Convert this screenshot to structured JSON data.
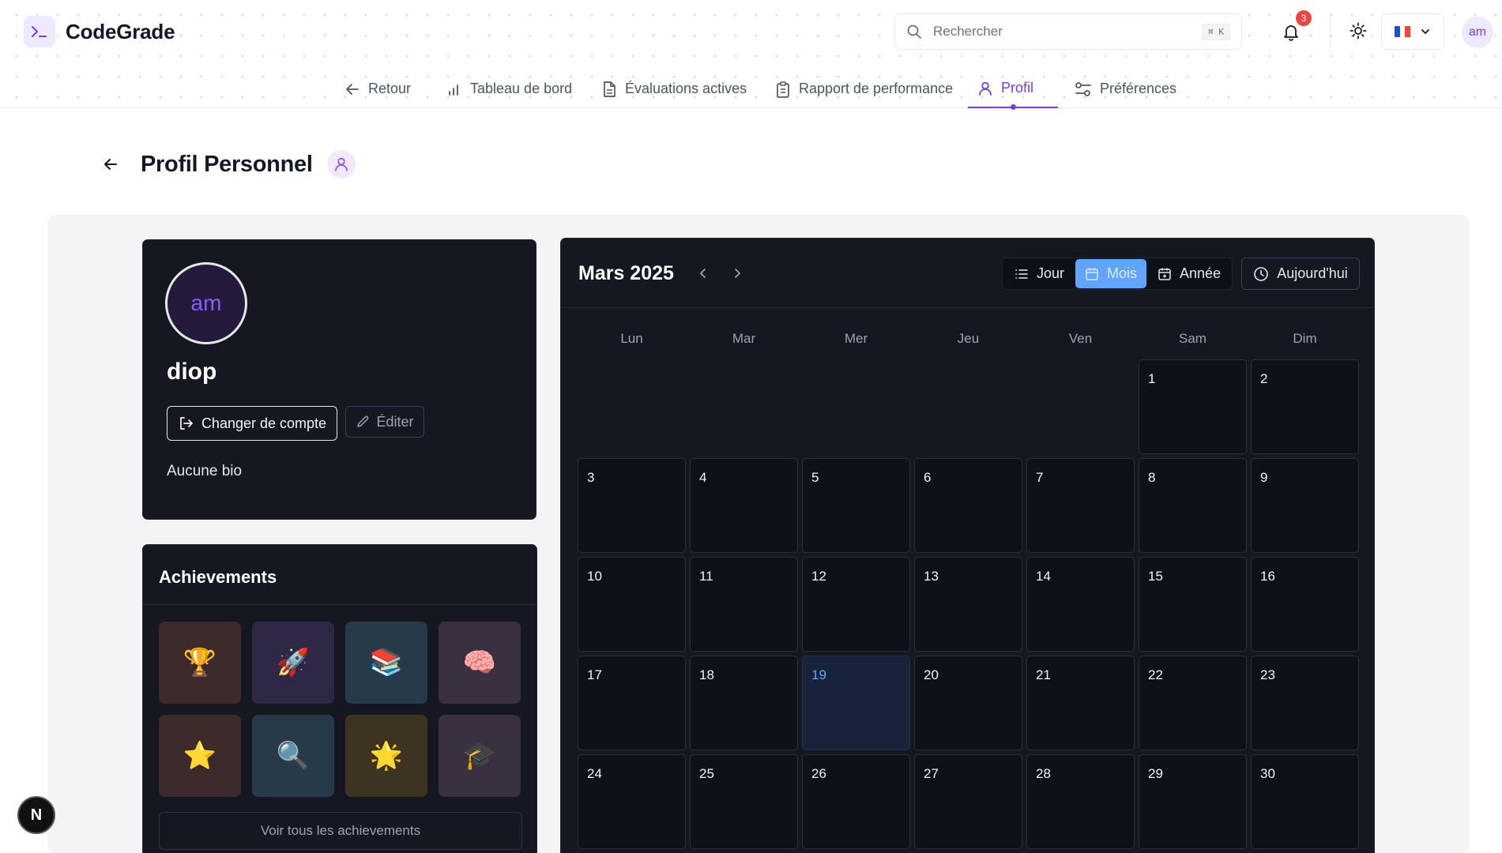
{
  "app": {
    "name": "CodeGrade"
  },
  "search": {
    "placeholder": "Rechercher",
    "shortcut": "⌘ K"
  },
  "notifications": {
    "count": "3"
  },
  "user": {
    "initials": "am"
  },
  "language": {
    "flag": "fr"
  },
  "nav": {
    "items": [
      {
        "label": "Retour",
        "icon": "arrow-left-icon"
      },
      {
        "label": "Tableau de bord",
        "icon": "bar-chart-icon"
      },
      {
        "label": "Évaluations actives",
        "icon": "document-icon"
      },
      {
        "label": "Rapport de performance",
        "icon": "clipboard-icon"
      },
      {
        "label": "Profil",
        "icon": "user-icon",
        "active": true
      },
      {
        "label": "Préférences",
        "icon": "sliders-icon"
      }
    ]
  },
  "page": {
    "title": "Profil Personnel"
  },
  "profile": {
    "initials": "am",
    "username": "diop",
    "switch_label": "Changer de compte",
    "edit_label": "Éditer",
    "bio": "Aucune bio"
  },
  "achievements": {
    "title": "Achievements",
    "items": [
      {
        "icon": "trophy-icon",
        "emoji": "🏆",
        "bg": "#3d2b2b"
      },
      {
        "icon": "rocket-icon",
        "emoji": "🚀",
        "bg": "#2f2845"
      },
      {
        "icon": "books-icon",
        "emoji": "📚",
        "bg": "#273a4a"
      },
      {
        "icon": "brain-icon",
        "emoji": "🧠",
        "bg": "#3a3140"
      },
      {
        "icon": "star-icon",
        "emoji": "⭐",
        "bg": "#3d2b2b"
      },
      {
        "icon": "magnifier-icon",
        "emoji": "🔍",
        "bg": "#273a4a"
      },
      {
        "icon": "sparkle-icon",
        "emoji": "🌟",
        "bg": "#3d3322"
      },
      {
        "icon": "graduation-cap-icon",
        "emoji": "🎓",
        "bg": "#3a3140"
      }
    ],
    "view_all": "Voir tous les achievements"
  },
  "calendar": {
    "month_label": "Mars 2025",
    "views": [
      "Jour",
      "Mois",
      "Année"
    ],
    "active_view": "Mois",
    "today_label": "Aujourd'hui",
    "weekdays": [
      "Lun",
      "Mar",
      "Mer",
      "Jeu",
      "Ven",
      "Sam",
      "Dim"
    ],
    "leading_blanks": 5,
    "days_shown": 30,
    "today": 19
  },
  "next_badge": "N"
}
